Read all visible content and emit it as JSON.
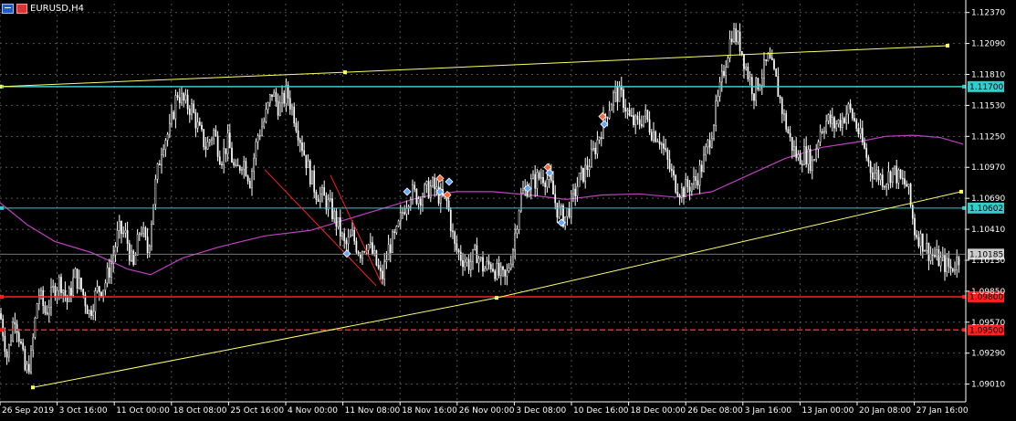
{
  "window": {
    "symbol_label": "EURUSD,H4",
    "icons": [
      "chart-window-icon",
      "flag-icon"
    ]
  },
  "colors": {
    "background": "#000000",
    "candle": "#ffffff",
    "grid": "#ffffff",
    "ma": "#c040c0",
    "trendline": "#ffff66",
    "cyan_line": "#33cccc",
    "red_line": "#ff2020",
    "axis_text": "#ffffff"
  },
  "chart_data": {
    "type": "candlestick",
    "symbol": "EURUSD",
    "timeframe": "H4",
    "y_range": [
      1.0885,
      1.1245
    ],
    "y_ticks": [
      "1.12370",
      "1.12090",
      "1.11810",
      "1.11530",
      "1.11250",
      "1.10970",
      "1.10690",
      "1.10410",
      "1.10130",
      "1.09850",
      "1.09570",
      "1.09290",
      "1.09010"
    ],
    "x_ticks": [
      "26 Sep 2019",
      "3 Oct 16:00",
      "11 Oct 00:00",
      "18 Oct 08:00",
      "25 Oct 16:00",
      "4 Nov 00:00",
      "11 Nov 08:00",
      "18 Nov 16:00",
      "26 Nov 00:00",
      "3 Dec 08:00",
      "10 Dec 16:00",
      "18 Dec 00:00",
      "26 Dec 08:00",
      "3 Jan 16:00",
      "13 Jan 00:00",
      "20 Jan 08:00",
      "27 Jan 16:00"
    ],
    "close_path": [
      [
        0,
        1.0965
      ],
      [
        8,
        1.0925
      ],
      [
        16,
        1.0965
      ],
      [
        22,
        1.094
      ],
      [
        28,
        1.091
      ],
      [
        34,
        1.0925
      ],
      [
        42,
        1.0985
      ],
      [
        50,
        1.0965
      ],
      [
        58,
        1.0985
      ],
      [
        66,
        1.0995
      ],
      [
        74,
        1.0975
      ],
      [
        82,
        1.1
      ],
      [
        90,
        1.0985
      ],
      [
        98,
        1.0965
      ],
      [
        106,
        1.0985
      ],
      [
        114,
        1.099
      ],
      [
        122,
        1.101
      ],
      [
        130,
        1.104
      ],
      [
        138,
        1.1035
      ],
      [
        146,
        1.1005
      ],
      [
        154,
        1.1045
      ],
      [
        162,
        1.102
      ],
      [
        170,
        1.108
      ],
      [
        178,
        1.112
      ],
      [
        186,
        1.113
      ],
      [
        194,
        1.1165
      ],
      [
        202,
        1.1155
      ],
      [
        210,
        1.115
      ],
      [
        218,
        1.113
      ],
      [
        226,
        1.1115
      ],
      [
        234,
        1.113
      ],
      [
        242,
        1.1105
      ],
      [
        250,
        1.112
      ],
      [
        258,
        1.109
      ],
      [
        266,
        1.1105
      ],
      [
        274,
        1.1085
      ],
      [
        282,
        1.1125
      ],
      [
        290,
        1.114
      ],
      [
        298,
        1.1165
      ],
      [
        306,
        1.115
      ],
      [
        314,
        1.1165
      ],
      [
        322,
        1.1145
      ],
      [
        330,
        1.112
      ],
      [
        338,
        1.1095
      ],
      [
        346,
        1.1075
      ],
      [
        354,
        1.107
      ],
      [
        362,
        1.106
      ],
      [
        370,
        1.1045
      ],
      [
        378,
        1.1025
      ],
      [
        386,
        1.1035
      ],
      [
        394,
        1.102
      ],
      [
        402,
        1.103
      ],
      [
        410,
        1.1015
      ],
      [
        418,
        1.0995
      ],
      [
        426,
        1.1025
      ],
      [
        434,
        1.1035
      ],
      [
        442,
        1.106
      ],
      [
        450,
        1.1075
      ],
      [
        458,
        1.107
      ],
      [
        466,
        1.1075
      ],
      [
        474,
        1.108
      ],
      [
        482,
        1.107
      ],
      [
        490,
        1.1065
      ],
      [
        498,
        1.1025
      ],
      [
        506,
        1.1015
      ],
      [
        514,
        1.101
      ],
      [
        522,
        1.102
      ],
      [
        530,
        1.1005
      ],
      [
        538,
        1.101
      ],
      [
        546,
        1.1
      ],
      [
        554,
        1.0995
      ],
      [
        562,
        1.1025
      ],
      [
        570,
        1.107
      ],
      [
        578,
        1.108
      ],
      [
        586,
        1.1085
      ],
      [
        594,
        1.109
      ],
      [
        602,
        1.1085
      ],
      [
        610,
        1.106
      ],
      [
        618,
        1.105
      ],
      [
        626,
        1.1065
      ],
      [
        634,
        1.1085
      ],
      [
        642,
        1.1095
      ],
      [
        650,
        1.111
      ],
      [
        658,
        1.113
      ],
      [
        666,
        1.115
      ],
      [
        674,
        1.1165
      ],
      [
        682,
        1.116
      ],
      [
        690,
        1.114
      ],
      [
        698,
        1.1135
      ],
      [
        706,
        1.1145
      ],
      [
        714,
        1.113
      ],
      [
        722,
        1.1125
      ],
      [
        730,
        1.1105
      ],
      [
        738,
        1.1085
      ],
      [
        746,
        1.1075
      ],
      [
        754,
        1.108
      ],
      [
        762,
        1.1085
      ],
      [
        770,
        1.11
      ],
      [
        778,
        1.1125
      ],
      [
        786,
        1.1155
      ],
      [
        794,
        1.119
      ],
      [
        802,
        1.122
      ],
      [
        810,
        1.121
      ],
      [
        818,
        1.1185
      ],
      [
        826,
        1.1165
      ],
      [
        834,
        1.118
      ],
      [
        842,
        1.1195
      ],
      [
        850,
        1.1175
      ],
      [
        858,
        1.1145
      ],
      [
        866,
        1.112
      ],
      [
        874,
        1.1105
      ],
      [
        882,
        1.111
      ],
      [
        890,
        1.11
      ],
      [
        898,
        1.113
      ],
      [
        906,
        1.114
      ],
      [
        914,
        1.1135
      ],
      [
        922,
        1.114
      ],
      [
        930,
        1.115
      ],
      [
        938,
        1.1135
      ],
      [
        946,
        1.1115
      ],
      [
        954,
        1.1095
      ],
      [
        962,
        1.109
      ],
      [
        970,
        1.1085
      ],
      [
        978,
        1.1095
      ],
      [
        986,
        1.1085
      ],
      [
        994,
        1.108
      ],
      [
        1002,
        1.104
      ],
      [
        1010,
        1.103
      ],
      [
        1018,
        1.102
      ],
      [
        1026,
        1.1015
      ],
      [
        1034,
        1.101
      ],
      [
        1042,
        1.1005
      ],
      [
        1050,
        1.1015
      ]
    ],
    "ma_path": [
      [
        0,
        1.1065
      ],
      [
        30,
        1.1045
      ],
      [
        60,
        1.103
      ],
      [
        100,
        1.102
      ],
      [
        140,
        1.1005
      ],
      [
        165,
        1.1
      ],
      [
        200,
        1.1015
      ],
      [
        240,
        1.1025
      ],
      [
        290,
        1.1035
      ],
      [
        340,
        1.104
      ],
      [
        380,
        1.105
      ],
      [
        420,
        1.106
      ],
      [
        460,
        1.107
      ],
      [
        500,
        1.1075
      ],
      [
        540,
        1.1075
      ],
      [
        580,
        1.1072
      ],
      [
        620,
        1.1068
      ],
      [
        660,
        1.1072
      ],
      [
        700,
        1.1073
      ],
      [
        740,
        1.107
      ],
      [
        780,
        1.1075
      ],
      [
        820,
        1.109
      ],
      [
        860,
        1.1105
      ],
      [
        900,
        1.1115
      ],
      [
        940,
        1.112
      ],
      [
        970,
        1.1125
      ],
      [
        1000,
        1.1126
      ],
      [
        1030,
        1.1124
      ],
      [
        1055,
        1.1118
      ]
    ],
    "horizontal_lines": [
      {
        "name": "cyan-resistance",
        "price": 1.117,
        "label": "1.11700",
        "color": "#33cccc",
        "style": "solid"
      },
      {
        "name": "cyan-support",
        "price": 1.10602,
        "label": "1.10602",
        "color": "#33cccc",
        "style": "thin"
      },
      {
        "name": "current-price",
        "price": 1.10185,
        "label": "1.10185",
        "color": "#888888",
        "style": "bid"
      },
      {
        "name": "red-support-1",
        "price": 1.098,
        "label": "1.09800",
        "color": "#ff2020",
        "style": "solid"
      },
      {
        "name": "red-support-2",
        "price": 1.095,
        "label": "1.09500",
        "color": "#ff2020",
        "style": "dashed"
      }
    ],
    "trendlines": [
      {
        "name": "upper-channel-trendline",
        "color": "#ffff66",
        "points": [
          [
            0,
            1.117
          ],
          [
            378,
            1.1183
          ],
          [
            1038,
            1.1207
          ]
        ]
      },
      {
        "name": "lower-trendline",
        "color": "#ffff66",
        "points": [
          [
            36,
            1.0898
          ],
          [
            544,
            1.0979
          ],
          [
            1053,
            1.1075
          ]
        ]
      },
      {
        "name": "red-down-trendline-1",
        "color": "#ff2020",
        "points": [
          [
            290,
            1.1095
          ],
          [
            412,
            1.099
          ]
        ]
      },
      {
        "name": "red-down-trendline-2",
        "color": "#ff2020",
        "points": [
          [
            362,
            1.109
          ],
          [
            418,
            1.0992
          ]
        ]
      }
    ],
    "markers": [
      {
        "x": 380,
        "price": 1.1019,
        "color": "#66aaff"
      },
      {
        "x": 446,
        "price": 1.1075,
        "color": "#66aaff"
      },
      {
        "x": 482,
        "price": 1.1087,
        "color": "#ff6633"
      },
      {
        "x": 490,
        "price": 1.1072,
        "color": "#ff6633"
      },
      {
        "x": 482,
        "price": 1.1075,
        "color": "#66aaff"
      },
      {
        "x": 492,
        "price": 1.1084,
        "color": "#66aaff"
      },
      {
        "x": 578,
        "price": 1.1078,
        "color": "#66aaff"
      },
      {
        "x": 600,
        "price": 1.1097,
        "color": "#ff6633"
      },
      {
        "x": 602,
        "price": 1.1092,
        "color": "#66aaff"
      },
      {
        "x": 615,
        "price": 1.1047,
        "color": "#66aaff"
      },
      {
        "x": 660,
        "price": 1.1143,
        "color": "#ff6633"
      },
      {
        "x": 662,
        "price": 1.1136,
        "color": "#66aaff"
      }
    ]
  }
}
